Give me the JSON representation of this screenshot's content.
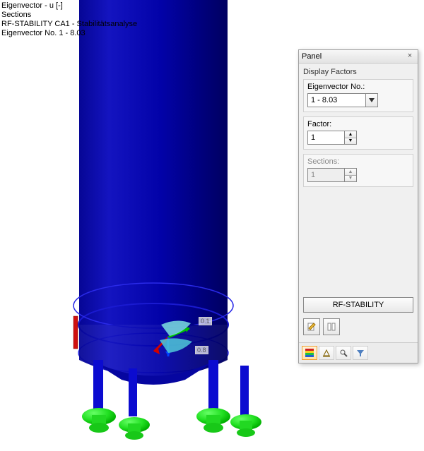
{
  "overlay": {
    "line1": "Eigenvector - u [-]",
    "line2": "Sections",
    "line3": "RF-STABILITY CA1 - Stabilitätsanalyse",
    "line4": "Eigenvector No. 1  -  8.03"
  },
  "scene": {
    "label_top": "0.1",
    "label_bottom": "0.8"
  },
  "panel": {
    "title": "Panel",
    "subtitle": "Display Factors",
    "eigenvector": {
      "label": "Eigenvector No.:",
      "value": "1 - 8.03"
    },
    "factor": {
      "label": "Factor:",
      "value": "1"
    },
    "sections": {
      "label": "Sections:",
      "value": "1"
    },
    "action_button": "RF-STABILITY"
  }
}
